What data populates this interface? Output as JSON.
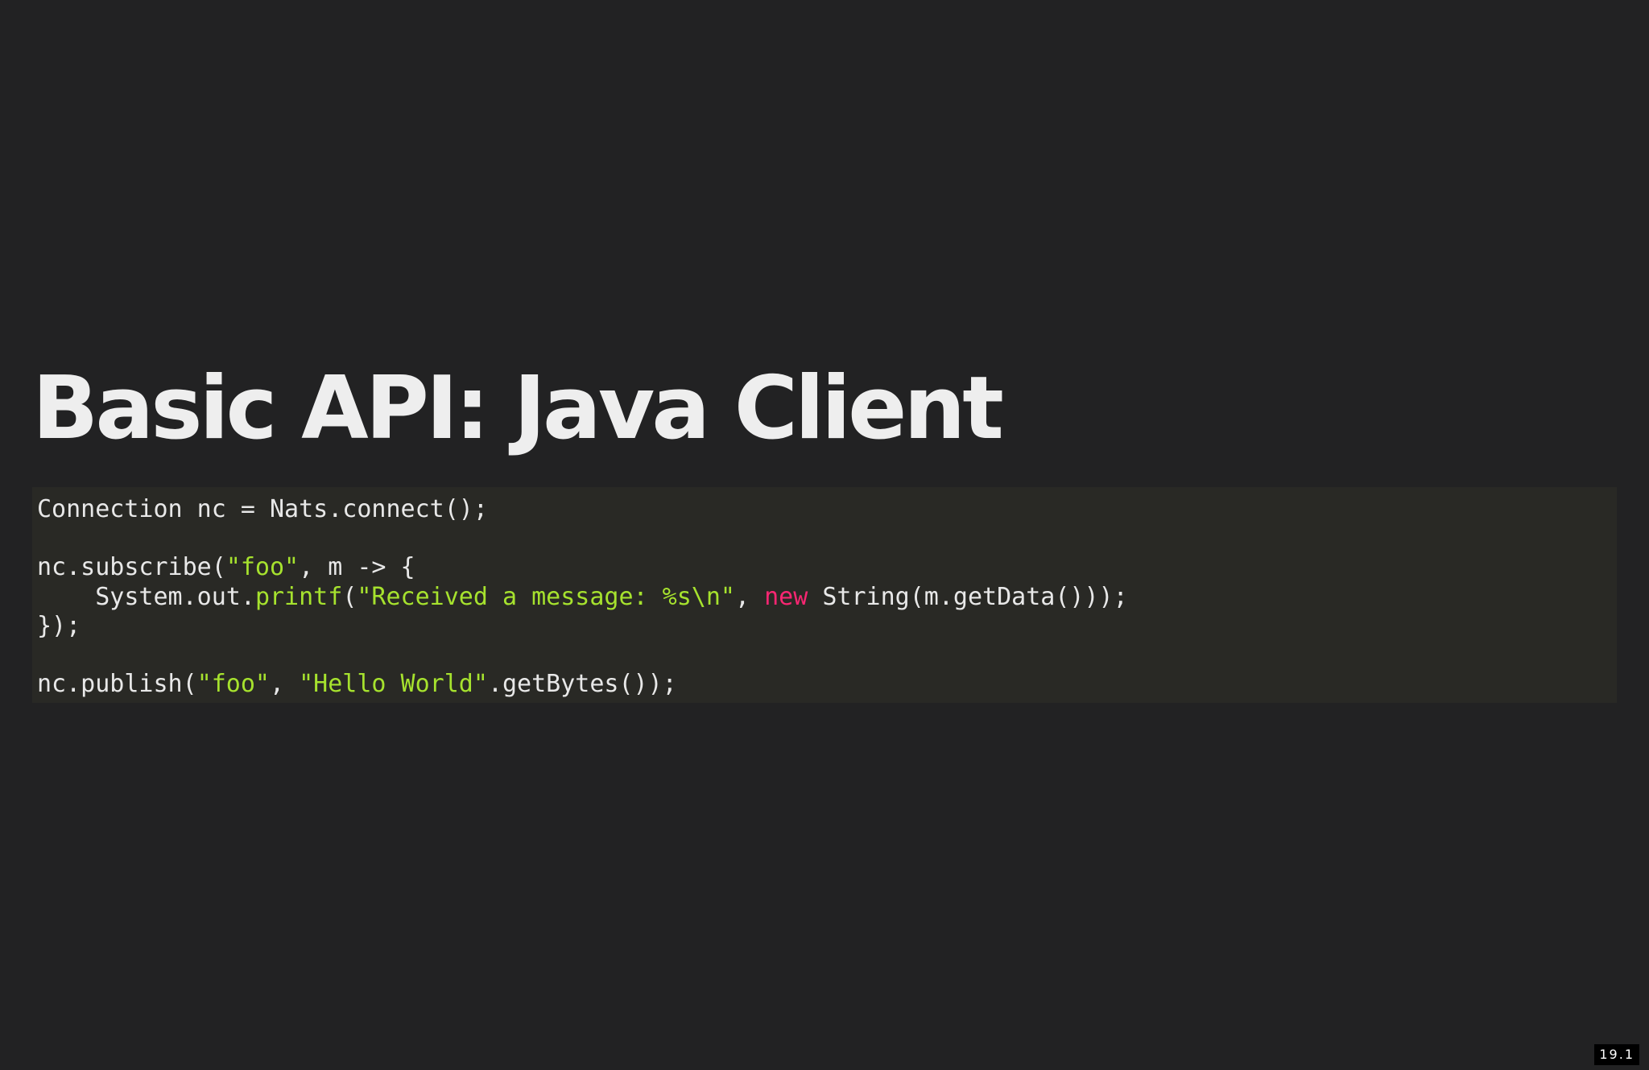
{
  "slide": {
    "title": "Basic API: Java Client",
    "slide_number": "19.1"
  },
  "code": {
    "line1": {
      "a": "Connection nc = Nats.connect();"
    },
    "line3": {
      "a": "nc.subscribe(",
      "b": "\"foo\"",
      "c": ", m -> {"
    },
    "line4": {
      "a": "    System.out.",
      "b": "printf",
      "c": "(",
      "d": "\"Received a message: %s\\n\"",
      "e": ", ",
      "f": "new",
      "g": " String(m.getData()));"
    },
    "line5": {
      "a": "});"
    },
    "line7": {
      "a": "nc.publish(",
      "b": "\"foo\"",
      "c": ", ",
      "d": "\"Hello World\"",
      "e": ".getBytes());"
    }
  },
  "colors": {
    "background": "#222223",
    "code_background": "#292925",
    "text": "#e8e8e8",
    "string": "#a6e22e",
    "keyword": "#f92672"
  }
}
